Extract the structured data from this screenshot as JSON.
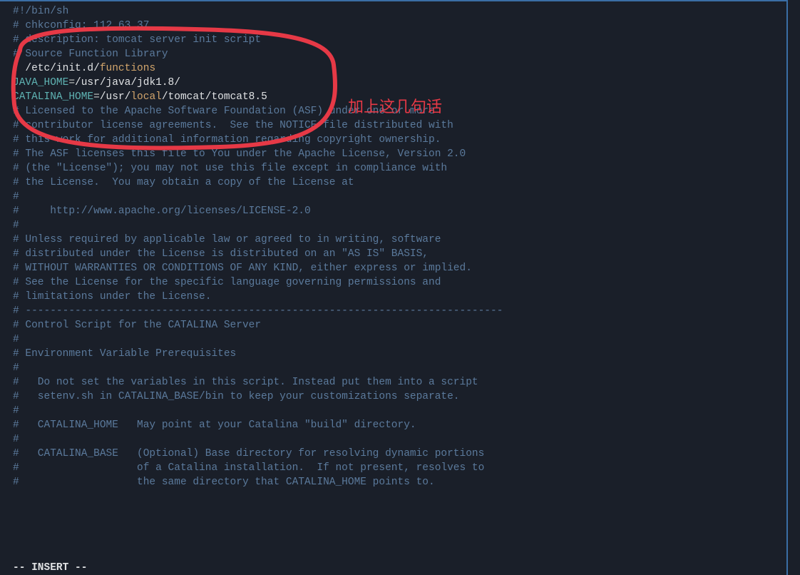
{
  "lines": {
    "l1": "#!/bin/sh",
    "l2": "",
    "l3": "# chkconfig: 112 63 37",
    "l4": "# description: tomcat server init script",
    "l5": "# Source Function Library",
    "l6_dot": ". ",
    "l6_path1": "/etc/init.d/",
    "l6_path2": "functions",
    "l7": "",
    "l8_var": "JAVA_HOME",
    "l8_eq": "=",
    "l8_val": "/usr/java/jdk1.8/",
    "l9_var": "CATALINA_HOME",
    "l9_eq": "=",
    "l9_val1": "/usr/",
    "l9_val2": "local",
    "l9_val3": "/tomcat/tomcat8.5",
    "l10": "",
    "l11": "# Licensed to the Apache Software Foundation (ASF) under one or more",
    "l12": "# contributor license agreements.  See the NOTICE file distributed with",
    "l13": "# this work for additional information regarding copyright ownership.",
    "l14": "# The ASF licenses this file to You under the Apache License, Version 2.0",
    "l15": "# (the \"License\"); you may not use this file except in compliance with",
    "l16": "# the License.  You may obtain a copy of the License at",
    "l17": "#",
    "l18": "#     http://www.apache.org/licenses/LICENSE-2.0",
    "l19": "#",
    "l20": "# Unless required by applicable law or agreed to in writing, software",
    "l21": "# distributed under the License is distributed on an \"AS IS\" BASIS,",
    "l22": "# WITHOUT WARRANTIES OR CONDITIONS OF ANY KIND, either express or implied.",
    "l23": "# See the License for the specific language governing permissions and",
    "l24": "# limitations under the License.",
    "l25": "",
    "l26": "# -----------------------------------------------------------------------------",
    "l27": "# Control Script for the CATALINA Server",
    "l28": "#",
    "l29": "# Environment Variable Prerequisites",
    "l30": "#",
    "l31": "#   Do not set the variables in this script. Instead put them into a script",
    "l32": "#   setenv.sh in CATALINA_BASE/bin to keep your customizations separate.",
    "l33": "#",
    "l34": "#   CATALINA_HOME   May point at your Catalina \"build\" directory.",
    "l35": "#",
    "l36": "#   CATALINA_BASE   (Optional) Base directory for resolving dynamic portions",
    "l37": "#                   of a Catalina installation.  If not present, resolves to",
    "l38": "#                   the same directory that CATALINA_HOME points to."
  },
  "status": "-- INSERT --",
  "annotation": "加上这几句话"
}
